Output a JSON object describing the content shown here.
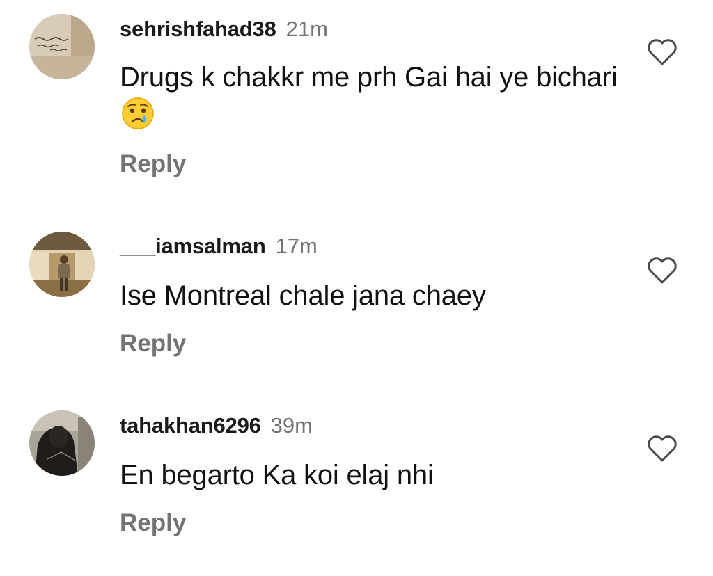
{
  "comments": [
    {
      "username": "sehrishfahad38",
      "time": "21m",
      "text": "Drugs k chakkr me prh Gai hai ye bichari",
      "emoji": "crying-face",
      "reply_label": "Reply",
      "like_icon": "heart-outline-icon"
    },
    {
      "username": "___iamsalman",
      "time": "17m",
      "text": "Ise Montreal chale jana chaey",
      "reply_label": "Reply",
      "like_icon": "heart-outline-icon"
    },
    {
      "username": "tahakhan6296",
      "time": "39m",
      "text": "En begarto Ka koi elaj nhi",
      "reply_label": "Reply",
      "like_icon": "heart-outline-icon"
    }
  ],
  "colors": {
    "username": "#1a1a1a",
    "secondary_text": "#737373",
    "body_text": "#111111",
    "background": "#ffffff"
  }
}
